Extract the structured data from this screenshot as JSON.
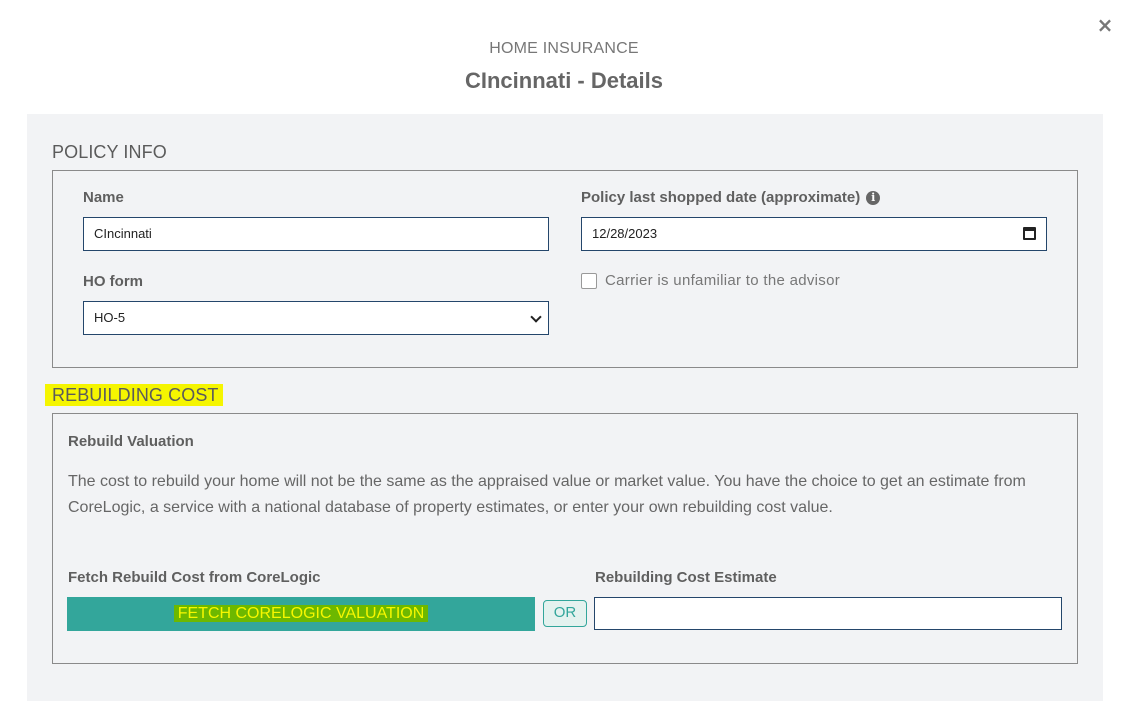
{
  "modal": {
    "kicker": "HOME INSURANCE",
    "title": "CIncinnati - Details",
    "close_glyph": "×"
  },
  "policy_info": {
    "heading": "POLICY INFO",
    "name_label": "Name",
    "name_value": "CIncinnati",
    "date_label": "Policy last shopped date (approximate)",
    "date_value": "12/28/2023",
    "info_glyph": "i",
    "ho_form_label": "HO form",
    "ho_form_value": "HO-5",
    "carrier_checkbox_label": "Carrier is unfamiliar to the advisor",
    "carrier_checked": false
  },
  "rebuilding_cost": {
    "heading": "REBUILDING COST",
    "subtitle": "Rebuild Valuation",
    "description_line1": "The cost to rebuild your home will not be the same as the appraised value or market value. You have the choice to get an estimate from",
    "description_line2": "CoreLogic, a service with a national database of property estimates, or enter your own rebuilding cost value.",
    "fetch_label": "Fetch Rebuild Cost from CoreLogic",
    "fetch_button": "FETCH CORELOGIC VALUATION",
    "or_label": "OR",
    "estimate_label": "Rebuilding Cost Estimate",
    "estimate_value": ""
  },
  "colors": {
    "accent": "#33a69b",
    "highlight": "#f5f500",
    "input_border": "#24466b",
    "panel_bg": "#f2f3f5"
  },
  "icons": [
    "close-icon",
    "info-icon",
    "calendar-icon",
    "chevron-down-icon"
  ]
}
